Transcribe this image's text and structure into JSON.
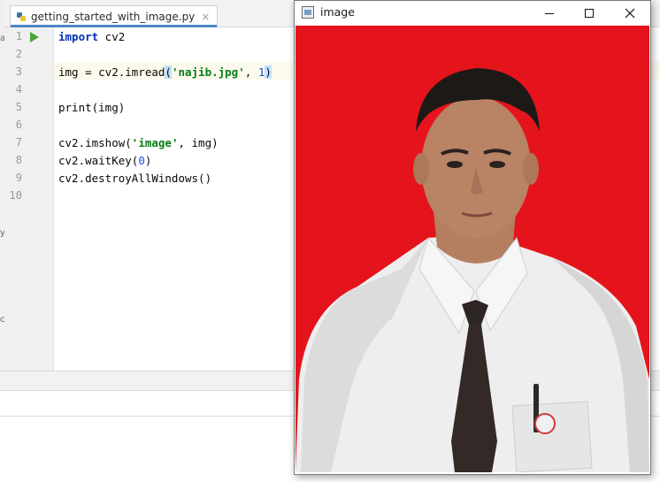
{
  "ide": {
    "tab_label": "getting_started_with_image.py",
    "tab_close": "×",
    "lines": [
      {
        "n": "1"
      },
      {
        "n": "2"
      },
      {
        "n": "3"
      },
      {
        "n": "4"
      },
      {
        "n": "5"
      },
      {
        "n": "6"
      },
      {
        "n": "7"
      },
      {
        "n": "8"
      },
      {
        "n": "9"
      },
      {
        "n": "10"
      }
    ],
    "code": {
      "l1_kw": "import",
      "l1_rest": " cv2",
      "l3_pre": "img = cv2.imread",
      "l3_open": "(",
      "l3_str": "'najib.jpg'",
      "l3_mid": ", ",
      "l3_num": "1",
      "l3_close": ")",
      "l5": "print(img)",
      "l7_pre": "cv2.imshow(",
      "l7_str": "'image'",
      "l7_post": ", img)",
      "l8_pre": "cv2.waitKey(",
      "l8_num": "0",
      "l8_post": ")",
      "l9": "cv2.destroyAllWindows()"
    },
    "edge_chars": [
      "a",
      "y",
      "c"
    ]
  },
  "image_window": {
    "title": "image",
    "minimize": "—",
    "close": "✕",
    "photo": {
      "background": "#e5141c",
      "subject": "portrait photo"
    }
  }
}
